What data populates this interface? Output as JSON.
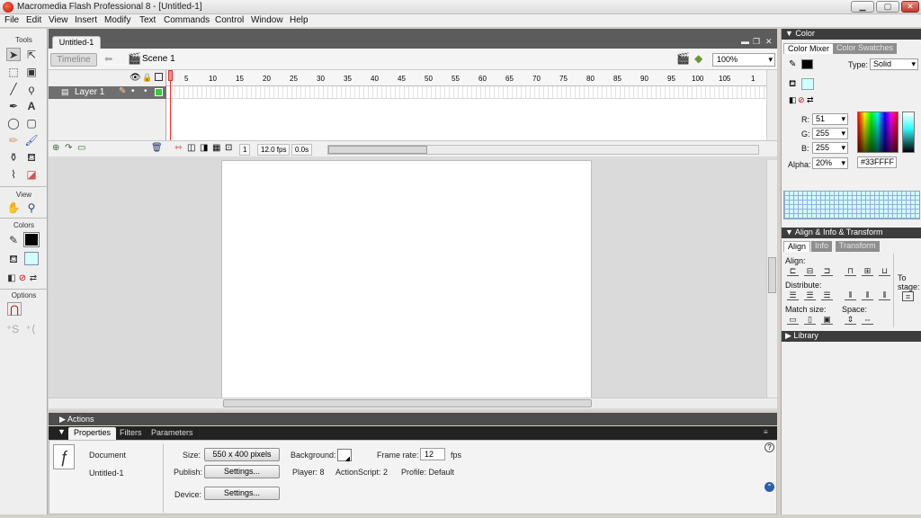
{
  "app": {
    "title": "Macromedia Flash Professional 8 - [Untitled-1]",
    "window_buttons": {
      "minimize": "▁",
      "maximize": "▢",
      "close": "✕"
    }
  },
  "menu": [
    "File",
    "Edit",
    "View",
    "Insert",
    "Modify",
    "Text",
    "Commands",
    "Control",
    "Window",
    "Help"
  ],
  "tools": {
    "header": "Tools",
    "view_header": "View",
    "colors_header": "Colors",
    "options_header": "Options"
  },
  "document": {
    "tab": "Untitled-1",
    "timeline_button": "Timeline",
    "scene": "Scene 1",
    "zoom": "100%",
    "layer": "Layer 1",
    "ruler_ticks": [
      "5",
      "10",
      "15",
      "20",
      "25",
      "30",
      "35",
      "40",
      "45",
      "50",
      "55",
      "60",
      "65",
      "70",
      "75",
      "80",
      "85",
      "90",
      "95",
      "100",
      "105",
      "1"
    ],
    "current_frame": "1",
    "frame_rate": "12.0 fps",
    "elapsed": "0.0s"
  },
  "actions_panel": {
    "label": "Actions"
  },
  "properties": {
    "tabs": [
      "Properties",
      "Filters",
      "Parameters"
    ],
    "doc_label": "Document",
    "doc_name": "Untitled-1",
    "size_label": "Size:",
    "size_value": "550 x 400 pixels",
    "background_label": "Background:",
    "frame_rate_label": "Frame rate:",
    "frame_rate_value": "12",
    "fps_unit": "fps",
    "publish_label": "Publish:",
    "settings_label": "Settings...",
    "player_label": "Player: 8",
    "actionscript_label": "ActionScript: 2",
    "profile_label": "Profile: Default",
    "device_label": "Device:",
    "device_settings_label": "Settings..."
  },
  "color_panel": {
    "header": "Color",
    "tabs": [
      "Color Mixer",
      "Color Swatches"
    ],
    "type_label": "Type:",
    "type_value": "Solid",
    "r_label": "R:",
    "r_value": "51",
    "g_label": "G:",
    "g_value": "255",
    "b_label": "B:",
    "b_value": "255",
    "alpha_label": "Alpha:",
    "alpha_value": "20%",
    "hex_value": "#33FFFF"
  },
  "align_panel": {
    "header": "Align & Info & Transform",
    "tabs": [
      "Align",
      "Info",
      "Transform"
    ],
    "align_label": "Align:",
    "distribute_label": "Distribute:",
    "match_size_label": "Match size:",
    "space_label": "Space:",
    "to_stage_label": "To stage:"
  },
  "library_panel": {
    "header": "Library"
  },
  "colors": {
    "accent": "#33FFFF",
    "panel_header": "#3d3d3d",
    "playhead": "#ff2b2b"
  }
}
